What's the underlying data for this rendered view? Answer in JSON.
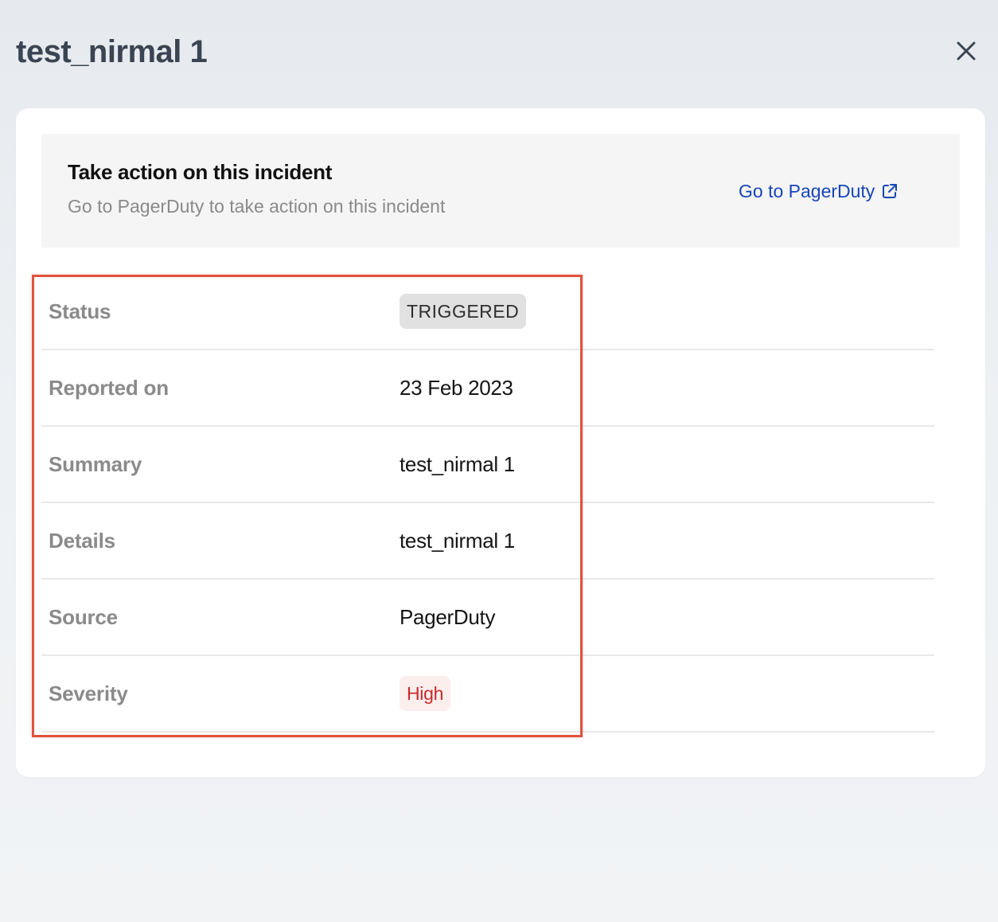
{
  "header": {
    "title": "test_nirmal 1",
    "close_icon": "close-icon"
  },
  "action_banner": {
    "title": "Take action on this incident",
    "subtitle": "Go to PagerDuty to take action on this incident",
    "link_label": "Go to PagerDuty",
    "link_icon": "external-link-icon",
    "link_color": "#1646b8"
  },
  "details": {
    "rows": [
      {
        "label": "Status",
        "value": "TRIGGERED"
      },
      {
        "label": "Reported on",
        "value": "23 Feb 2023"
      },
      {
        "label": "Summary",
        "value": "test_nirmal 1"
      },
      {
        "label": "Details",
        "value": "test_nirmal 1"
      },
      {
        "label": "Source",
        "value": "PagerDuty"
      },
      {
        "label": "Severity",
        "value": "High"
      }
    ]
  },
  "colors": {
    "highlight_border": "#e0523c",
    "severity_high_text": "#cc2a2a",
    "severity_high_bg": "#fdeeee",
    "status_badge_bg": "#e1e1e1"
  }
}
